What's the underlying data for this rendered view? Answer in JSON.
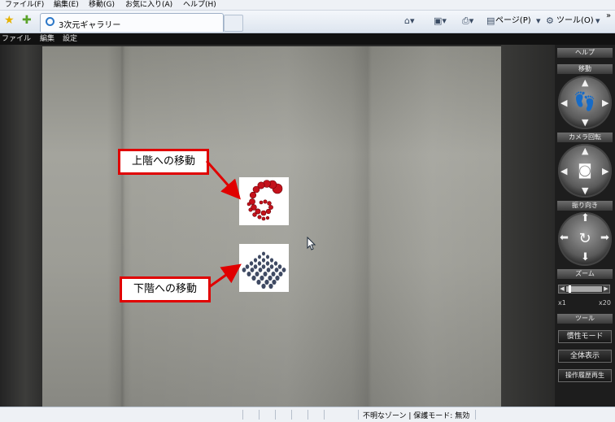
{
  "browser": {
    "menu": [
      "ファイル(F)",
      "編集(E)",
      "移動(G)",
      "お気に入り(A)",
      "ヘルプ(H)"
    ],
    "tab_title": "3次元ギャラリー",
    "commands": {
      "page": "ページ(P)",
      "tools": "ツール(O)",
      "more": "»"
    },
    "status_text": "不明なゾーン | 保護モード: 無効"
  },
  "app": {
    "menu": [
      "ファイル",
      "編集",
      "設定"
    ],
    "callouts": {
      "up": "上階への移動",
      "down": "下階への移動"
    },
    "panel": {
      "help": "ヘルプ",
      "move": "移動",
      "camera_rotate": "カメラ回転",
      "rotate_direction": "振り向き",
      "zoom": "ズーム",
      "zoom_min": "x1",
      "zoom_max": "x20",
      "tools": "ツール",
      "buttons": [
        "慣性モード",
        "全体表示",
        "操作履歴再生"
      ]
    }
  },
  "colors": {
    "callout_border": "#e00000",
    "panel_bg": "#1d1d1d"
  }
}
